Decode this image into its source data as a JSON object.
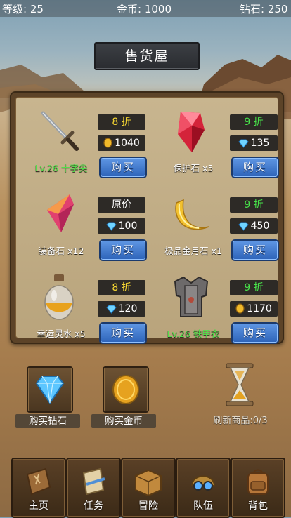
{
  "status": {
    "level_label": "等级: 25",
    "gold_label": "金币: 1000",
    "diamond_label": "钻石: 250"
  },
  "shop_title": "售货屋",
  "items": [
    {
      "name": "Lv.26 十字尖",
      "tag": "8 折",
      "price": "1040",
      "currency": "gold-coin-icon",
      "button": "购买",
      "icon": "dagger-icon"
    },
    {
      "name": "保护石 x5",
      "tag": "9 折",
      "price": "135",
      "currency": "diamond-icon",
      "button": "购买",
      "icon": "red-gem-icon"
    },
    {
      "name": "装备石 x12",
      "tag": "原价",
      "price": "100",
      "currency": "diamond-icon",
      "button": "购买",
      "icon": "pink-crystal-icon"
    },
    {
      "name": "极品金月石 x1",
      "tag": "9 折",
      "price": "450",
      "currency": "diamond-icon",
      "button": "购买",
      "icon": "golden-moon-stone-icon"
    },
    {
      "name": "幸运灵水 x5",
      "tag": "8 折",
      "price": "120",
      "currency": "diamond-icon",
      "button": "购买",
      "icon": "luck-potion-icon"
    },
    {
      "name": "Lv.26 铁甲衣",
      "tag": "9 折",
      "price": "1170",
      "currency": "gold-coin-icon",
      "button": "购买",
      "icon": "iron-armor-icon"
    }
  ],
  "shortcuts": {
    "buy_diamond": "购买钻石",
    "buy_gold": "购买金币",
    "refresh": "刷新商品:0/3"
  },
  "nav": [
    {
      "label": "主页",
      "icon": "home-book-icon"
    },
    {
      "label": "任务",
      "icon": "scroll-icon"
    },
    {
      "label": "冒险",
      "icon": "map-box-icon"
    },
    {
      "label": "队伍",
      "icon": "helmet-icon"
    },
    {
      "label": "背包",
      "icon": "backpack-icon"
    }
  ],
  "colors": {
    "discount_yellow": "#f5d632",
    "discount_green": "#48e34a",
    "button_blue": "#3b74cc",
    "item_name_green": "#52e04a"
  }
}
